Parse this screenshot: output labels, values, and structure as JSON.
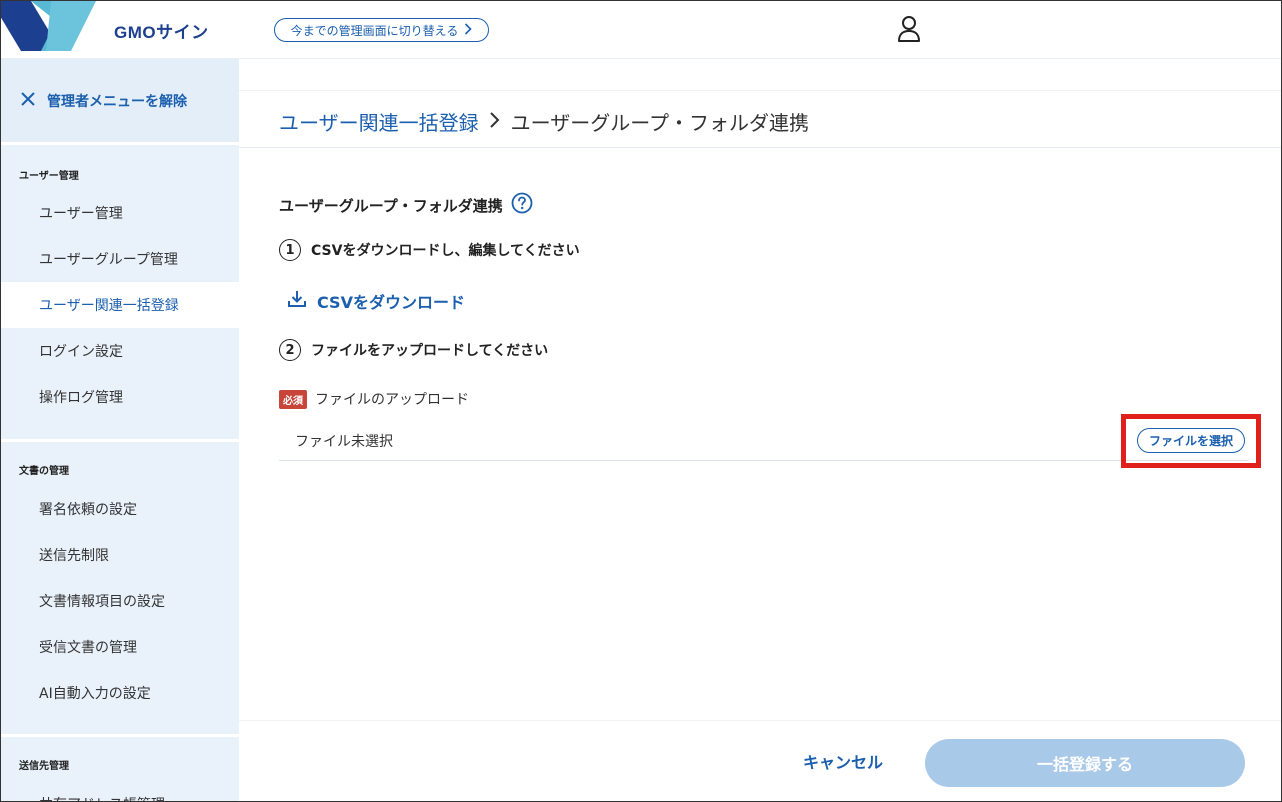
{
  "header": {
    "logo_text": "GMOサイン",
    "switch_label": "今までの管理画面に切り替える"
  },
  "sidebar": {
    "release_label": "管理者メニューを解除",
    "sections": [
      {
        "title": "ユーザー管理",
        "items": [
          "ユーザー管理",
          "ユーザーグループ管理",
          "ユーザー関連一括登録",
          "ログイン設定",
          "操作ログ管理"
        ]
      },
      {
        "title": "文書の管理",
        "items": [
          "署名依頼の設定",
          "送信先制限",
          "文書情報項目の設定",
          "受信文書の管理",
          "AI自動入力の設定"
        ]
      },
      {
        "title": "送信先管理",
        "items": [
          "共有アドレス帳管理"
        ]
      }
    ],
    "active_item": "ユーザー関連一括登録"
  },
  "main": {
    "breadcrumb": {
      "link": "ユーザー関連一括登録",
      "current": "ユーザーグループ・フォルダ連携"
    },
    "section_title": "ユーザーグループ・フォルダ連携",
    "step1": {
      "num": "1",
      "text": "CSVをダウンロードし、編集してください"
    },
    "download_label": "CSVをダウンロード",
    "step2": {
      "num": "2",
      "text": "ファイルをアップロードしてください"
    },
    "required_badge": "必須",
    "upload_label": "ファイルのアップロード",
    "file_status": "ファイル未選択",
    "select_file_label": "ファイルを選択"
  },
  "footer": {
    "cancel_label": "キャンセル",
    "submit_label": "一括登録する"
  },
  "colors": {
    "accent": "#1b5fae",
    "sidebar_bg": "#e9f2fb",
    "required": "#c8453a",
    "highlight": "#e0201b",
    "submit_disabled": "#a9c9e8"
  }
}
